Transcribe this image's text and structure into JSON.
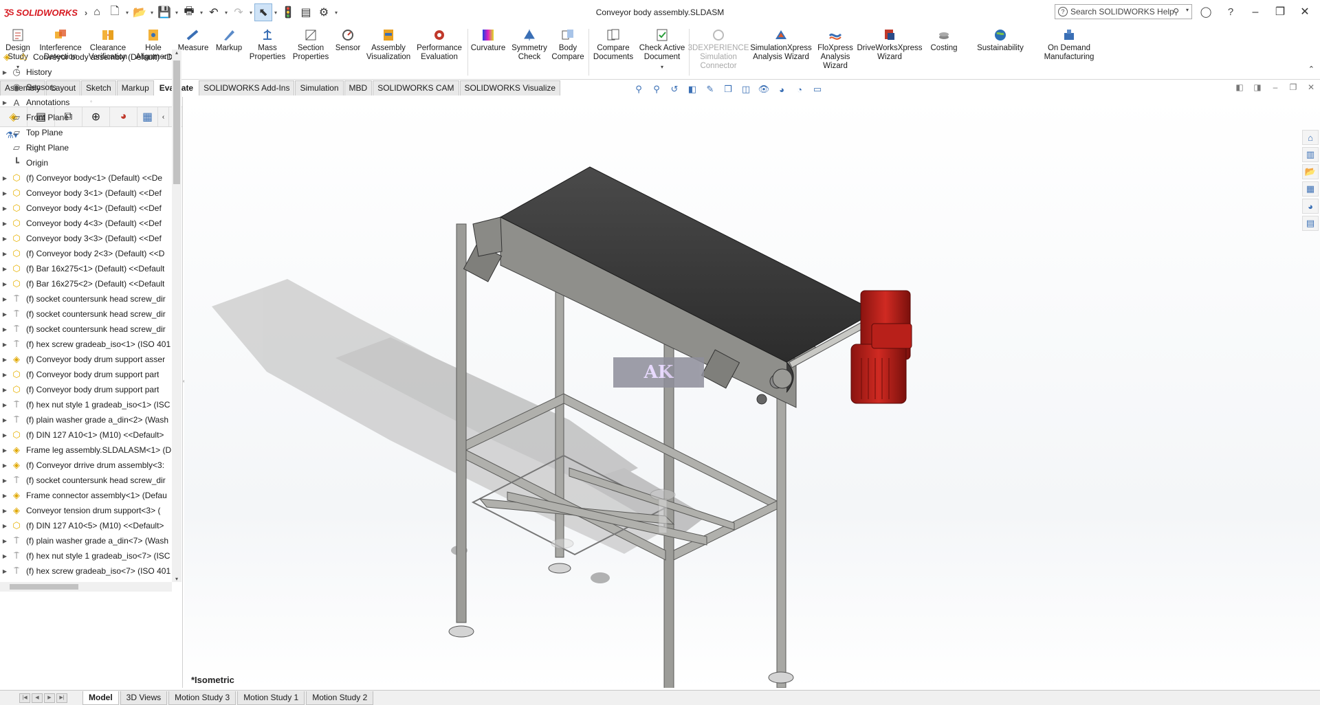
{
  "app": {
    "name": "SOLIDWORKS",
    "document_title": "Conveyor body assembly.SLDASM"
  },
  "search": {
    "placeholder": "Search SOLIDWORKS Help"
  },
  "ribbon": {
    "commands": [
      {
        "label": "Design\nStudy",
        "icon": "design-study-icon",
        "dropdown": true
      },
      {
        "label": "Interference\nDetection",
        "icon": "interference-detection-icon"
      },
      {
        "label": "Clearance\nVerification",
        "icon": "clearance-verification-icon"
      },
      {
        "label": "Hole\nAlignment",
        "icon": "hole-alignment-icon"
      },
      {
        "label": "Measure",
        "icon": "measure-icon"
      },
      {
        "label": "Markup",
        "icon": "markup-icon"
      },
      {
        "label": "Mass\nProperties",
        "icon": "mass-properties-icon"
      },
      {
        "label": "Section\nProperties",
        "icon": "section-properties-icon"
      },
      {
        "label": "Sensor",
        "icon": "sensor-icon"
      },
      {
        "label": "Assembly\nVisualization",
        "icon": "assembly-visualization-icon"
      },
      {
        "label": "Performance\nEvaluation",
        "icon": "performance-evaluation-icon"
      },
      {
        "label": "Curvature",
        "icon": "curvature-icon"
      },
      {
        "label": "Symmetry\nCheck",
        "icon": "symmetry-check-icon"
      },
      {
        "label": "Body\nCompare",
        "icon": "body-compare-icon"
      },
      {
        "label": "Compare\nDocuments",
        "icon": "compare-documents-icon"
      },
      {
        "label": "Check Active\nDocument",
        "icon": "check-active-document-icon",
        "dropdown": true
      },
      {
        "label": "3DEXPERIENCE\nSimulation\nConnector",
        "icon": "3dexperience-icon",
        "disabled": true
      },
      {
        "label": "SimulationXpress\nAnalysis Wizard",
        "icon": "simulationxpress-icon"
      },
      {
        "label": "FloXpress\nAnalysis\nWizard",
        "icon": "floxpress-icon"
      },
      {
        "label": "DriveWorksXpress\nWizard",
        "icon": "driveworksxpress-icon"
      },
      {
        "label": "Costing",
        "icon": "costing-icon"
      },
      {
        "label": "Sustainability",
        "icon": "sustainability-icon"
      },
      {
        "label": "On Demand\nManufacturing",
        "icon": "on-demand-manufacturing-icon"
      }
    ]
  },
  "tabs": [
    {
      "label": "Assembly"
    },
    {
      "label": "Layout"
    },
    {
      "label": "Sketch"
    },
    {
      "label": "Markup"
    },
    {
      "label": "Evaluate",
      "active": true
    },
    {
      "label": "SOLIDWORKS Add-Ins"
    },
    {
      "label": "Simulation"
    },
    {
      "label": "MBD"
    },
    {
      "label": "SOLIDWORKS CAM"
    },
    {
      "label": "SOLIDWORKS Visualize"
    }
  ],
  "tree": {
    "root": "Conveyor body assembly (Default) <D",
    "items": [
      {
        "label": "History",
        "icon": "history-icon",
        "expand": true
      },
      {
        "label": "Sensors",
        "icon": "sensors-icon",
        "expand": false
      },
      {
        "label": "Annotations",
        "icon": "annotations-icon",
        "expand": true
      },
      {
        "label": "Front Plane",
        "icon": "plane-icon",
        "expand": false
      },
      {
        "label": "Top Plane",
        "icon": "plane-icon",
        "expand": false
      },
      {
        "label": "Right Plane",
        "icon": "plane-icon",
        "expand": false
      },
      {
        "label": "Origin",
        "icon": "origin-icon",
        "expand": false
      },
      {
        "label": "(f) Conveyor body<1> (Default) <<De",
        "icon": "part-icon",
        "expand": true
      },
      {
        "label": "Conveyor body 3<1> (Default) <<Def",
        "icon": "part-icon",
        "expand": true
      },
      {
        "label": "Conveyor body 4<1> (Default) <<Def",
        "icon": "part-icon",
        "expand": true
      },
      {
        "label": "Conveyor body 4<3> (Default) <<Def",
        "icon": "part-icon",
        "expand": true
      },
      {
        "label": "Conveyor body 3<3> (Default) <<Def",
        "icon": "part-icon",
        "expand": true
      },
      {
        "label": "(f) Conveyor body 2<3> (Default) <<D",
        "icon": "part-icon",
        "expand": true
      },
      {
        "label": "(f) Bar 16x275<1> (Default) <<Default",
        "icon": "part-icon",
        "expand": true
      },
      {
        "label": "(f) Bar 16x275<2> (Default) <<Default",
        "icon": "part-icon",
        "expand": true
      },
      {
        "label": "(f) socket countersunk head screw_dir",
        "icon": "screw-icon",
        "expand": true
      },
      {
        "label": "(f) socket countersunk head screw_dir",
        "icon": "screw-icon",
        "expand": true
      },
      {
        "label": "(f) socket countersunk head screw_dir",
        "icon": "screw-icon",
        "expand": true
      },
      {
        "label": "(f) hex screw gradeab_iso<1> (ISO 401",
        "icon": "screw-icon",
        "expand": true
      },
      {
        "label": "(f) Conveyor body drum support asser",
        "icon": "assembly-icon",
        "expand": true
      },
      {
        "label": "(f) Conveyor body drum support part",
        "icon": "part-icon",
        "expand": true
      },
      {
        "label": "(f) Conveyor body drum support part",
        "icon": "part-icon",
        "expand": true
      },
      {
        "label": "(f) hex nut style 1 gradeab_iso<1> (ISC",
        "icon": "screw-icon",
        "expand": true
      },
      {
        "label": "(f) plain washer grade a_din<2> (Wash",
        "icon": "screw-icon",
        "expand": true
      },
      {
        "label": "(f) DIN 127 A10<1> (M10) <<Default>",
        "icon": "part-icon",
        "expand": true
      },
      {
        "label": "Frame leg assembly.SLDALASM<1> (D",
        "icon": "assembly-icon",
        "expand": true
      },
      {
        "label": "(f) Conveyor drrive drum assembly<3:",
        "icon": "assembly-icon",
        "expand": true
      },
      {
        "label": "(f) socket countersunk head screw_dir",
        "icon": "screw-icon",
        "expand": true
      },
      {
        "label": "Frame connector assembly<1> (Defau",
        "icon": "assembly-icon",
        "expand": true
      },
      {
        "label": "Conveyor tension drum support<3> (",
        "icon": "assembly-icon",
        "expand": true
      },
      {
        "label": "(f) DIN 127 A10<5> (M10) <<Default>",
        "icon": "part-icon",
        "expand": true
      },
      {
        "label": "(f) plain washer grade a_din<7> (Wash",
        "icon": "screw-icon",
        "expand": true
      },
      {
        "label": "(f) hex nut style 1 gradeab_iso<7> (ISC",
        "icon": "screw-icon",
        "expand": true
      },
      {
        "label": "(f) hex screw gradeab_iso<7> (ISO 401",
        "icon": "screw-icon",
        "expand": true
      }
    ]
  },
  "viewport": {
    "view_name": "*Isometric",
    "watermark": "AK"
  },
  "bottom_tabs": [
    {
      "label": "Model",
      "active": true
    },
    {
      "label": "3D Views"
    },
    {
      "label": "Motion Study 3"
    },
    {
      "label": "Motion Study 1"
    },
    {
      "label": "Motion Study 2"
    }
  ],
  "colors": {
    "brand": "#d71920",
    "motor": "#c0201e",
    "belt": "#3a3a3a",
    "frame": "#9c9c98",
    "accent": "#3a6fb5"
  }
}
